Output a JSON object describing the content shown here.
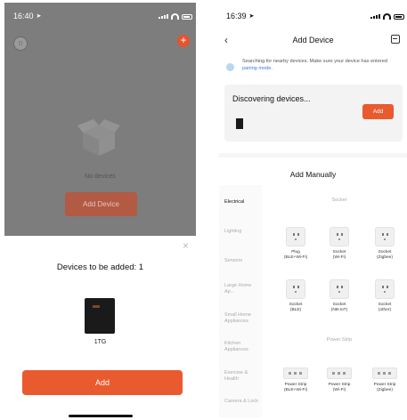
{
  "left": {
    "status_time": "16:40",
    "no_devices": "No devices",
    "add_device_button": "Add Device",
    "sheet_title": "Devices to be added: 1",
    "device_name": "1TG",
    "add_button": "Add"
  },
  "right": {
    "status_time": "16:39",
    "nav_title": "Add Device",
    "search_text": "Searching for nearby devices. Make sure your device has entered",
    "search_link": "pairing mode",
    "search_end": ".",
    "discovering_title": "Discovering devices...",
    "add_button": "Add",
    "add_manually_title": "Add Manually",
    "sidebar": [
      "Electrical",
      "Lighting",
      "Sensors",
      "Large Home Ap...",
      "Small Home Appliances",
      "Kitchen Appliances",
      "Exercise & Health",
      "Camera & Lock"
    ],
    "section_socket": "Socket",
    "section_power_strip": "Power Strip",
    "socket_items": [
      {
        "line1": "Plug",
        "line2": "(BLE+Wi-Fi)"
      },
      {
        "line1": "Socket",
        "line2": "(Wi-Fi)"
      },
      {
        "line1": "Socket",
        "line2": "(Zigbee)"
      },
      {
        "line1": "Socket",
        "line2": "(BLE)"
      },
      {
        "line1": "Socket",
        "line2": "(NB-IoT)"
      },
      {
        "line1": "Socket",
        "line2": "(other)"
      }
    ],
    "strip_items": [
      {
        "line1": "Power Strip",
        "line2": "(BLE+Wi-Fi)"
      },
      {
        "line1": "Power Strip",
        "line2": "(Wi-Fi)"
      },
      {
        "line1": "Power Strip",
        "line2": "(Zigbee)"
      }
    ]
  },
  "colors": {
    "accent": "#e95a2f",
    "link": "#3a7bd5"
  },
  "icons": [
    "location-arrow-icon",
    "signal-icon",
    "wifi-icon",
    "battery-icon",
    "avatar-icon",
    "plus-icon",
    "box-icon",
    "close-icon",
    "back-icon",
    "scan-icon",
    "bluetooth-icon",
    "socket-icon",
    "power-strip-icon"
  ]
}
